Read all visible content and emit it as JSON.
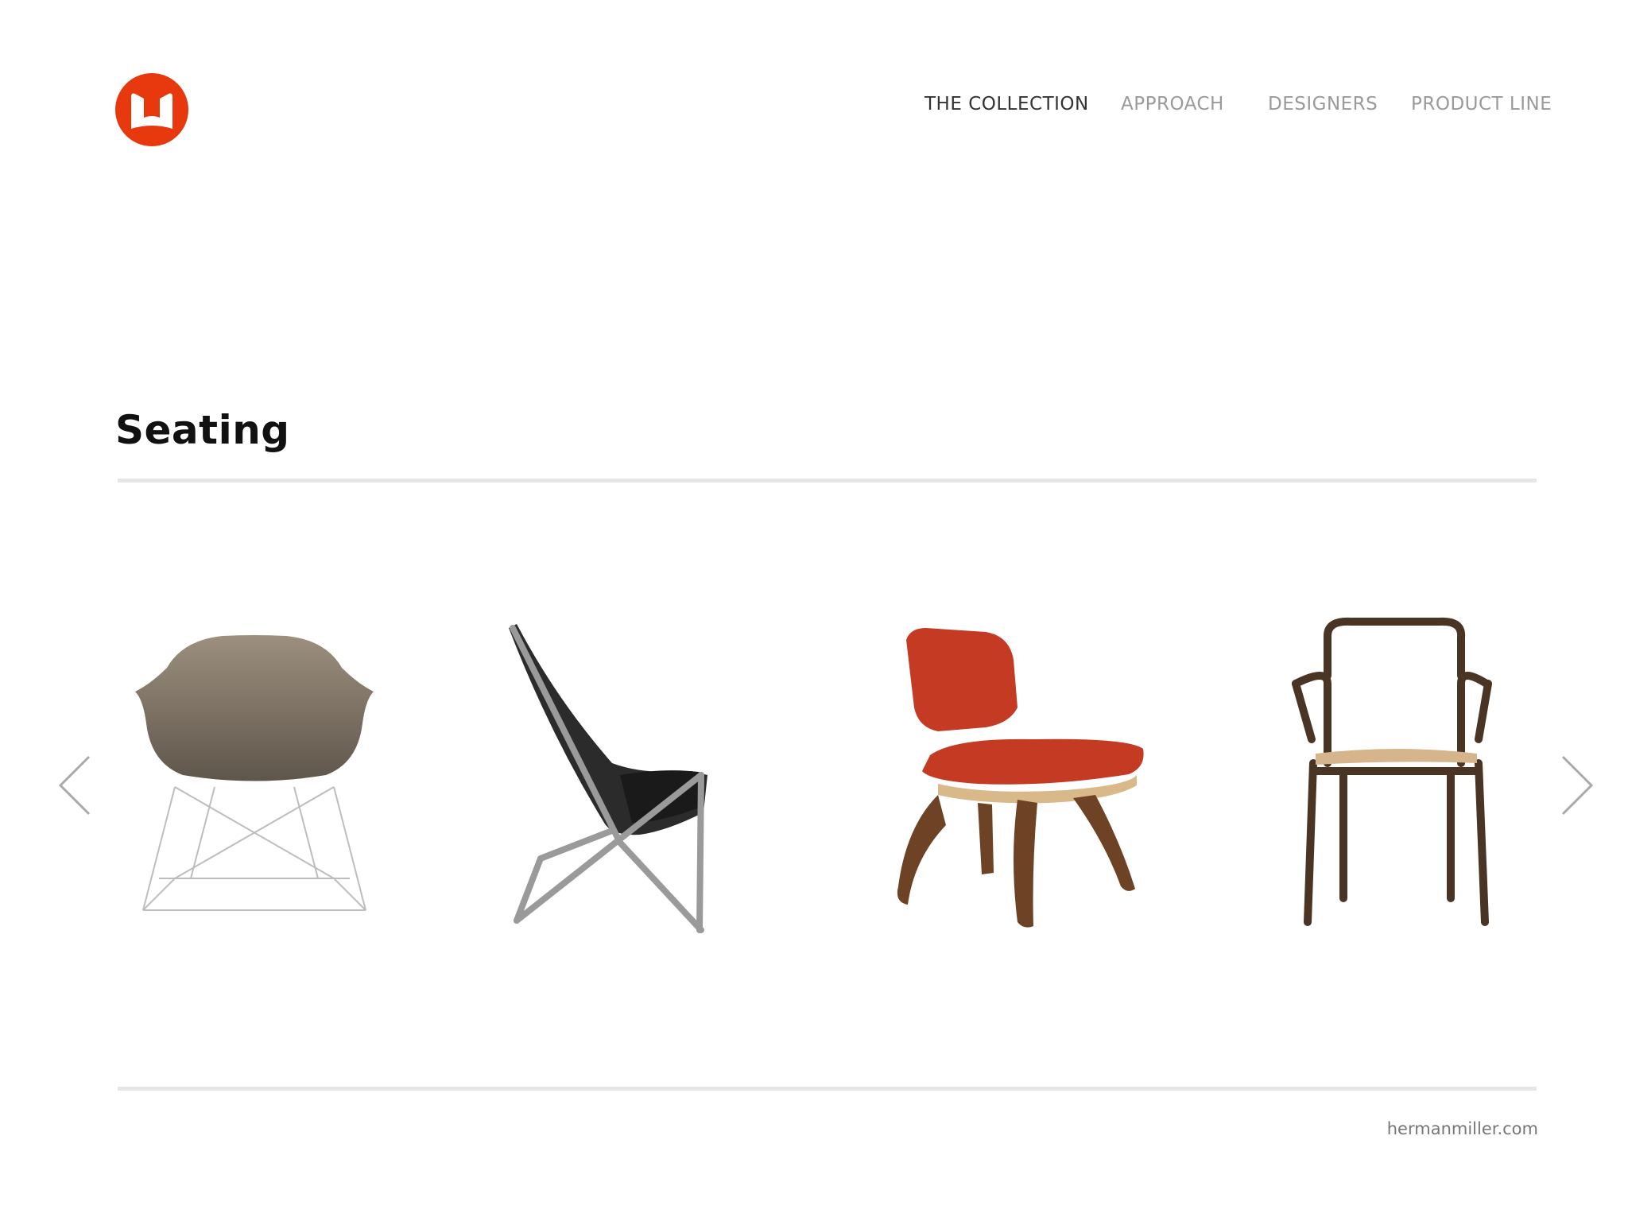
{
  "brand": {
    "logo_icon": "herman-miller-logo-icon",
    "logo_color": "#e8380d"
  },
  "nav": {
    "items": [
      {
        "label": "THE COLLECTION",
        "active": true
      },
      {
        "label": "APPROACH",
        "active": false
      },
      {
        "label": "DESIGNERS",
        "active": false
      },
      {
        "label": "PRODUCT LINE",
        "active": false
      }
    ]
  },
  "section": {
    "title": "Seating"
  },
  "carousel": {
    "prev_icon": "chevron-left-icon",
    "next_icon": "chevron-right-icon",
    "products": [
      {
        "image": "molded-shell-lounge-chair-image",
        "color": "#8a7d6b"
      },
      {
        "image": "scissor-chair-image",
        "color": "#2a2a2a"
      },
      {
        "image": "plywood-lounge-chair-image",
        "color": "#c43a22"
      },
      {
        "image": "wood-armchair-image",
        "color": "#4a3424"
      }
    ]
  },
  "footer": {
    "link": "hermanmiller.com"
  }
}
